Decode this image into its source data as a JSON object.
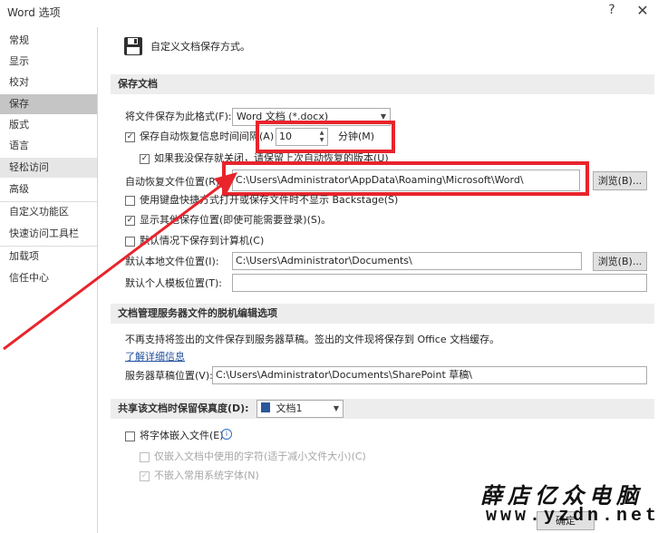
{
  "window": {
    "title": "Word 选项",
    "help_glyph": "?",
    "close_glyph": "✕"
  },
  "sidebar": {
    "items": [
      {
        "label": "常规"
      },
      {
        "label": "显示"
      },
      {
        "label": "校对"
      },
      {
        "label": "保存"
      },
      {
        "label": "版式"
      },
      {
        "label": "语言"
      },
      {
        "label": "轻松访问"
      },
      {
        "label": "高级"
      },
      {
        "label": "自定义功能区"
      },
      {
        "label": "快速访问工具栏"
      },
      {
        "label": "加载项"
      },
      {
        "label": "信任中心"
      }
    ],
    "selected": "保存"
  },
  "header": {
    "description": "自定义文档保存方式。",
    "icon": "save-disk-icon"
  },
  "save_docs": {
    "heading": "保存文档",
    "format_label": "将文件保存为此格式(F):",
    "format_value": "Word 文档 (*.docx)",
    "autorecover_label": "保存自动恢复信息时间间隔(A)",
    "autorecover_checked": true,
    "autorecover_minutes": "10",
    "minutes_label": "分钟(M)",
    "keep_last_label": "如果我没保存就关闭，请保留上次自动恢复的版本(U)",
    "keep_last_checked": true,
    "autorecover_location_label": "自动恢复文件位置(R):",
    "autorecover_location_value": "C:\\Users\\Administrator\\AppData\\Roaming\\Microsoft\\Word\\",
    "browse_label": "浏览(B)...",
    "no_backstage_label": "使用键盘快捷方式打开或保存文件时不显示 Backstage(S)",
    "no_backstage_checked": false,
    "show_more_label": "显示其他保存位置(即使可能需要登录)(S)。",
    "show_more_checked": true,
    "default_computer_label": "默认情况下保存到计算机(C)",
    "default_computer_checked": false,
    "default_local_label": "默认本地文件位置(I):",
    "default_local_value": "C:\\Users\\Administrator\\Documents\\",
    "browse2_label": "浏览(B)...",
    "default_template_label": "默认个人模板位置(T):",
    "default_template_value": ""
  },
  "offline": {
    "heading": "文档管理服务器文件的脱机编辑选项",
    "info": "不再支持将签出的文件保存到服务器草稿。签出的文件现将保存到 Office 文档缓存。",
    "learn_more": "了解详细信息",
    "drafts_label": "服务器草稿位置(V):",
    "drafts_value": "C:\\Users\\Administrator\\Documents\\SharePoint 草稿\\"
  },
  "fidelity": {
    "heading": "共享该文档时保留保真度(D):",
    "doc_value": "文档1",
    "doc_icon": "word-document-icon",
    "embed_fonts_label": "将字体嵌入文件(E)",
    "embed_fonts_checked": false,
    "info_icon": "info-icon",
    "embed_used_label": "仅嵌入文档中使用的字符(适于减小文件大小)(C)",
    "embed_used_checked": false,
    "no_common_label": "不嵌入常用系统字体(N)",
    "no_common_checked": true
  },
  "footer": {
    "ok_label": "确定"
  },
  "watermark": {
    "chinese": "薛店亿众电脑",
    "url": "www.yzdn.net"
  },
  "colors": {
    "annotation_red": "#e8242c",
    "selected_item": "#c5c5c5",
    "section_bg": "#ededed",
    "link": "#1f4e9c"
  }
}
